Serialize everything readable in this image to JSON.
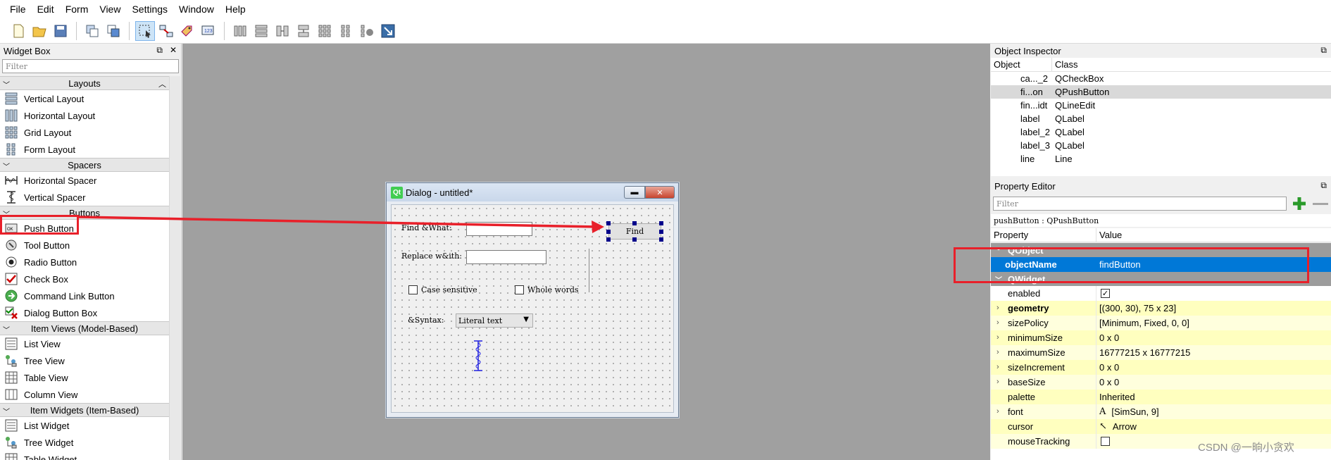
{
  "menu": [
    "File",
    "Edit",
    "Form",
    "View",
    "Settings",
    "Window",
    "Help"
  ],
  "widget_box": {
    "title": "Widget Box",
    "filter_placeholder": "Filter",
    "categories": [
      {
        "label": "Layouts",
        "items": [
          {
            "label": "Vertical Layout",
            "icon": "vertical-layout-icon"
          },
          {
            "label": "Horizontal Layout",
            "icon": "horizontal-layout-icon"
          },
          {
            "label": "Grid Layout",
            "icon": "grid-layout-icon"
          },
          {
            "label": "Form Layout",
            "icon": "form-layout-icon"
          }
        ]
      },
      {
        "label": "Spacers",
        "items": [
          {
            "label": "Horizontal Spacer",
            "icon": "horizontal-spacer-icon"
          },
          {
            "label": "Vertical Spacer",
            "icon": "vertical-spacer-icon"
          }
        ]
      },
      {
        "label": "Buttons",
        "items": [
          {
            "label": "Push Button",
            "icon": "push-button-icon"
          },
          {
            "label": "Tool Button",
            "icon": "tool-button-icon"
          },
          {
            "label": "Radio Button",
            "icon": "radio-button-icon"
          },
          {
            "label": "Check Box",
            "icon": "check-box-icon"
          },
          {
            "label": "Command Link Button",
            "icon": "command-link-icon"
          },
          {
            "label": "Dialog Button Box",
            "icon": "dialog-button-box-icon"
          }
        ]
      },
      {
        "label": "Item Views (Model-Based)",
        "items": [
          {
            "label": "List View",
            "icon": "list-view-icon"
          },
          {
            "label": "Tree View",
            "icon": "tree-view-icon"
          },
          {
            "label": "Table View",
            "icon": "table-view-icon"
          },
          {
            "label": "Column View",
            "icon": "column-view-icon"
          }
        ]
      },
      {
        "label": "Item Widgets (Item-Based)",
        "items": [
          {
            "label": "List Widget",
            "icon": "list-widget-icon"
          },
          {
            "label": "Tree Widget",
            "icon": "tree-widget-icon"
          },
          {
            "label": "Table Widget",
            "icon": "table-widget-icon"
          }
        ]
      }
    ]
  },
  "dialog": {
    "title": "Dialog - untitled*",
    "logo": "Qt",
    "find_label": "Find &What:",
    "replace_label": "Replace w&ith:",
    "find_button": "Find",
    "case_sensitive": "Case sensitive",
    "whole_words": "Whole words",
    "syntax_label": "&Syntax:",
    "syntax_value": "Literal text"
  },
  "object_inspector": {
    "title": "Object Inspector",
    "col_object": "Object",
    "col_class": "Class",
    "rows": [
      {
        "object": "ca..._2",
        "class": "QCheckBox",
        "selected": false
      },
      {
        "object": "fi...on",
        "class": "QPushButton",
        "selected": true
      },
      {
        "object": "fin...idt",
        "class": "QLineEdit",
        "selected": false
      },
      {
        "object": "label",
        "class": "QLabel",
        "selected": false
      },
      {
        "object": "label_2",
        "class": "QLabel",
        "selected": false
      },
      {
        "object": "label_3",
        "class": "QLabel",
        "selected": false
      },
      {
        "object": "line",
        "class": "Line",
        "selected": false
      }
    ]
  },
  "property_editor": {
    "title": "Property Editor",
    "filter_placeholder": "Filter",
    "object_line": "pushButton : QPushButton",
    "col_property": "Property",
    "col_value": "Value",
    "groups": [
      {
        "name": "QObject",
        "props": [
          {
            "key": "objectName",
            "value": "findButton",
            "style": "sel",
            "bold": true,
            "expandable": false
          }
        ]
      },
      {
        "name": "QWidget",
        "props": [
          {
            "key": "enabled",
            "value": "✓",
            "style": "",
            "bold": false,
            "expandable": false,
            "checkbox": true
          },
          {
            "key": "geometry",
            "value": "[(300, 30), 75 x 23]",
            "style": "y",
            "bold": true,
            "expandable": true
          },
          {
            "key": "sizePolicy",
            "value": "[Minimum, Fixed, 0, 0]",
            "style": "y2",
            "bold": false,
            "expandable": true
          },
          {
            "key": "minimumSize",
            "value": "0 x 0",
            "style": "y",
            "bold": false,
            "expandable": true
          },
          {
            "key": "maximumSize",
            "value": "16777215 x 16777215",
            "style": "y2",
            "bold": false,
            "expandable": true
          },
          {
            "key": "sizeIncrement",
            "value": "0 x 0",
            "style": "y",
            "bold": false,
            "expandable": true
          },
          {
            "key": "baseSize",
            "value": "0 x 0",
            "style": "y2",
            "bold": false,
            "expandable": true
          },
          {
            "key": "palette",
            "value": "Inherited",
            "style": "y",
            "bold": false,
            "expandable": false
          },
          {
            "key": "font",
            "value": "[SimSun, 9]",
            "style": "y2",
            "bold": false,
            "expandable": true,
            "prefix": "A"
          },
          {
            "key": "cursor",
            "value": "Arrow",
            "style": "y",
            "bold": false,
            "expandable": false,
            "prefix": "↖"
          },
          {
            "key": "mouseTracking",
            "value": "",
            "style": "y2",
            "bold": false,
            "expandable": false,
            "checkbox": true
          }
        ]
      }
    ]
  },
  "watermark": "CSDN @一晌小贪欢",
  "colors": {
    "highlight": "#e8202a",
    "selection": "#0078d7",
    "canvas": "#a0a0a0"
  }
}
